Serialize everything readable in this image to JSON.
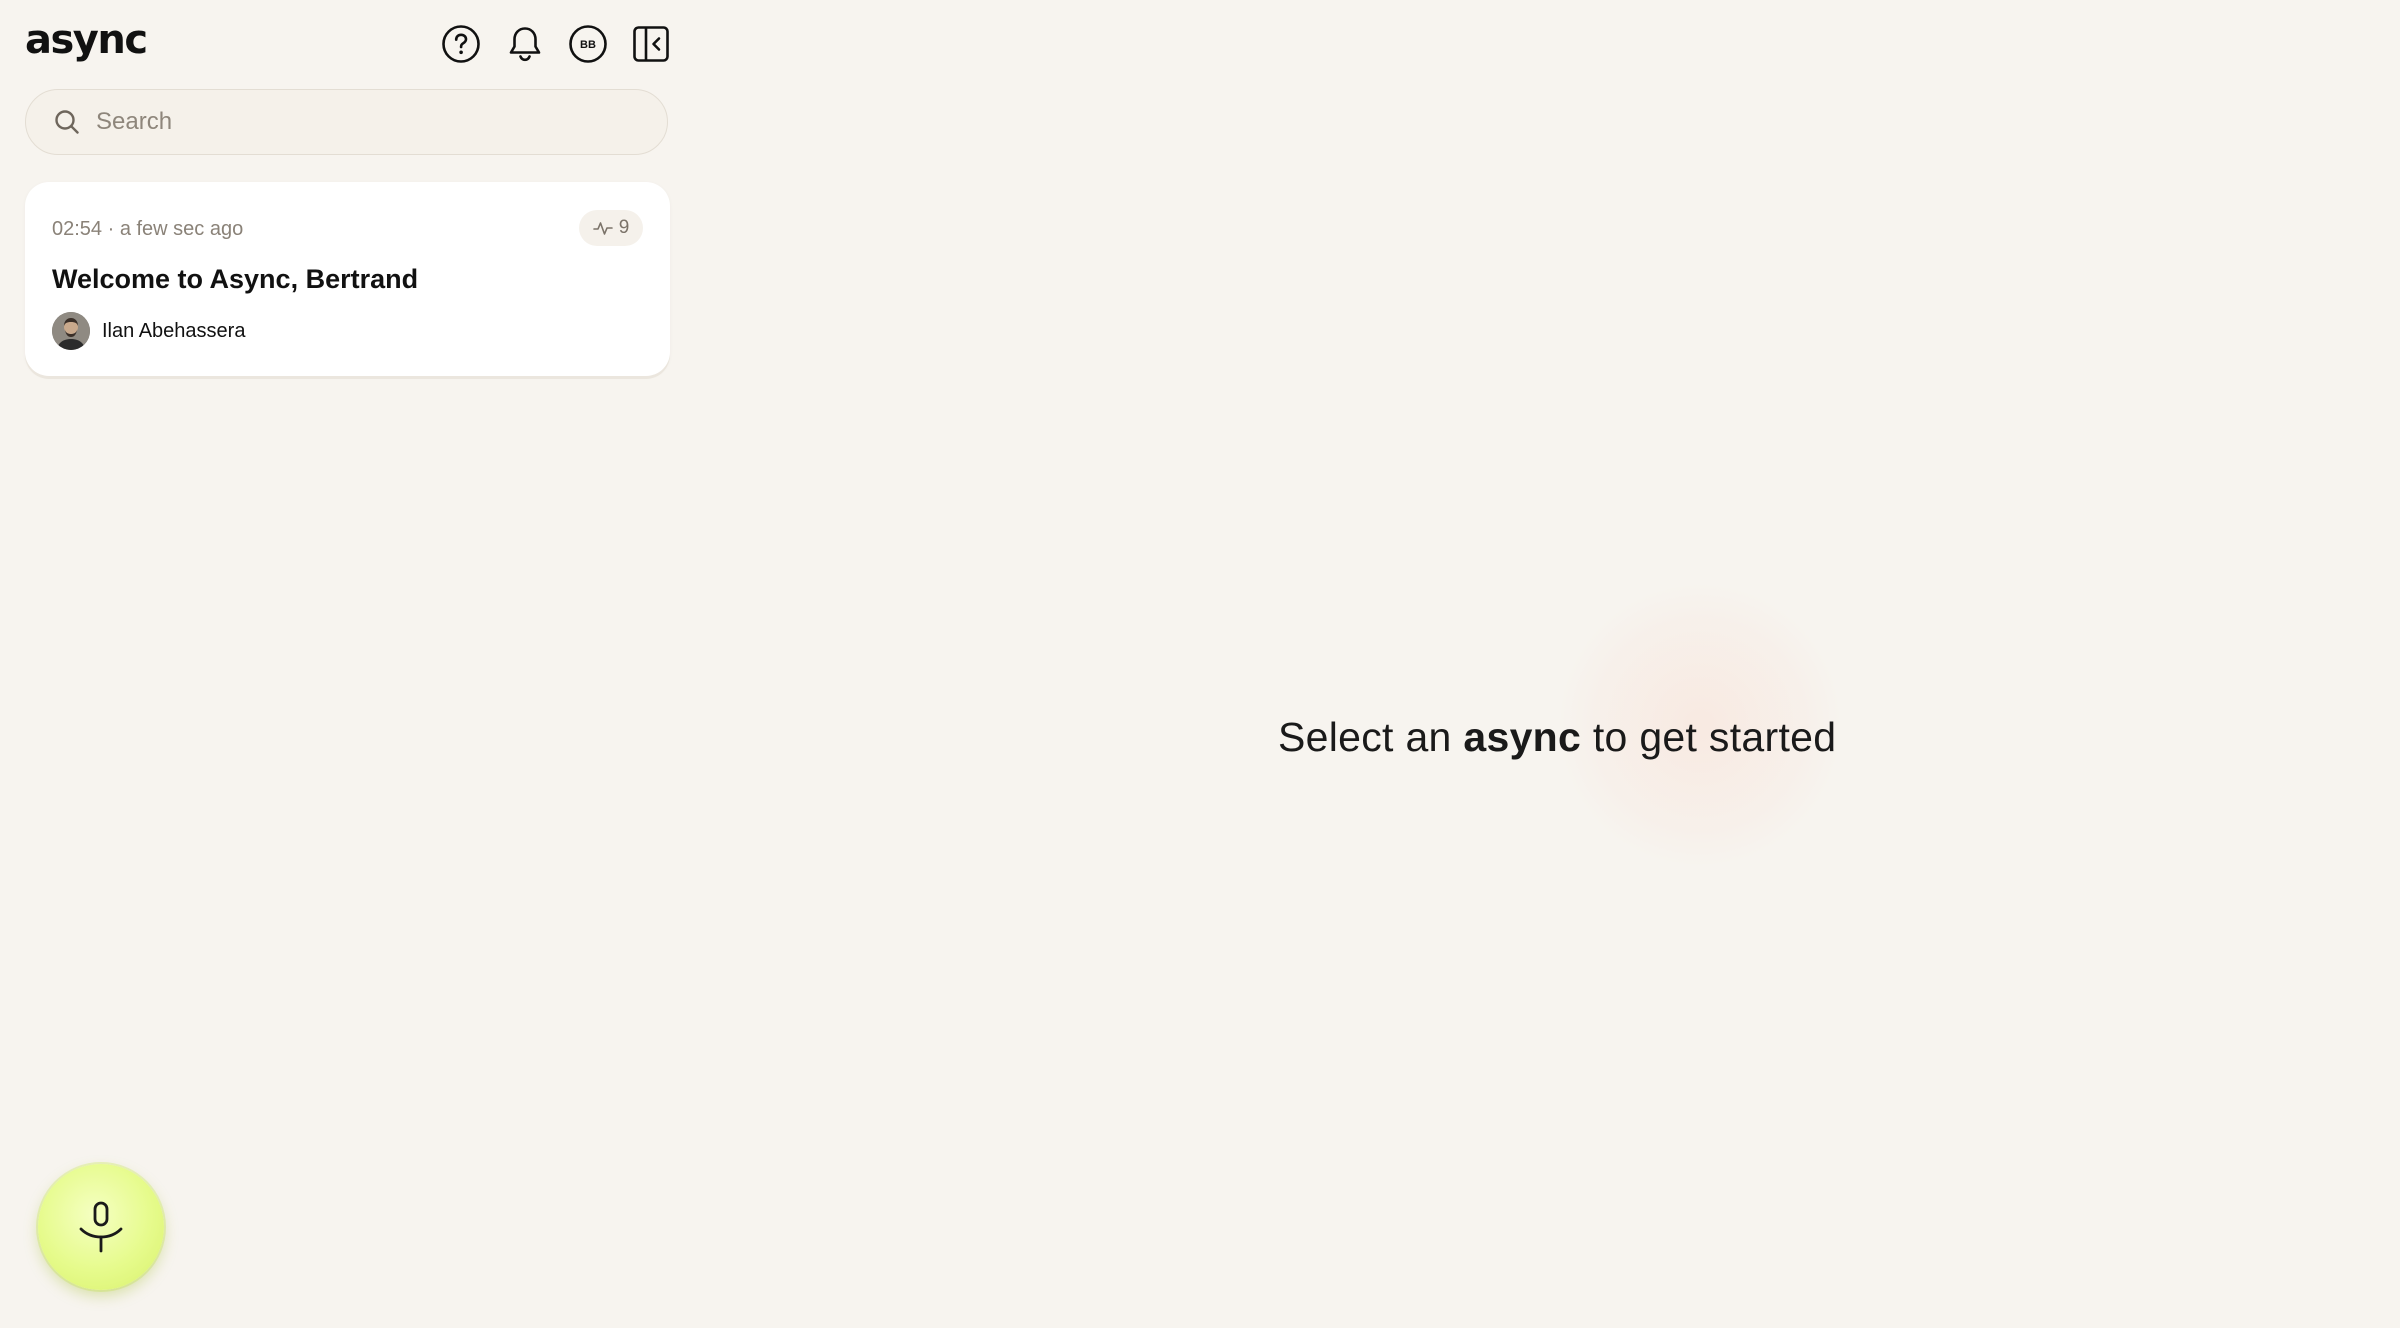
{
  "app": {
    "logo": "async"
  },
  "topbar": {
    "avatar_initials": "BB"
  },
  "search": {
    "placeholder": "Search"
  },
  "async_list": [
    {
      "time": "02:54 · a few sec ago",
      "activity_count": "9",
      "title": "Welcome to Async, Bertrand",
      "author": "Ilan Abehassera"
    }
  ],
  "main": {
    "empty_prefix": "Select an",
    "empty_bold": "async",
    "empty_suffix": "to get started"
  },
  "colors": {
    "background": "#f7f4ef",
    "card": "#ffffff",
    "record_button": "#e6fb8c",
    "muted_text": "#8a8278"
  },
  "icons": {
    "help": "help-icon",
    "notifications": "bell-icon",
    "profile": "avatar",
    "collapse": "sidebar-collapse-icon",
    "search": "search-icon",
    "activity": "activity-icon",
    "record": "microphone-icon"
  }
}
